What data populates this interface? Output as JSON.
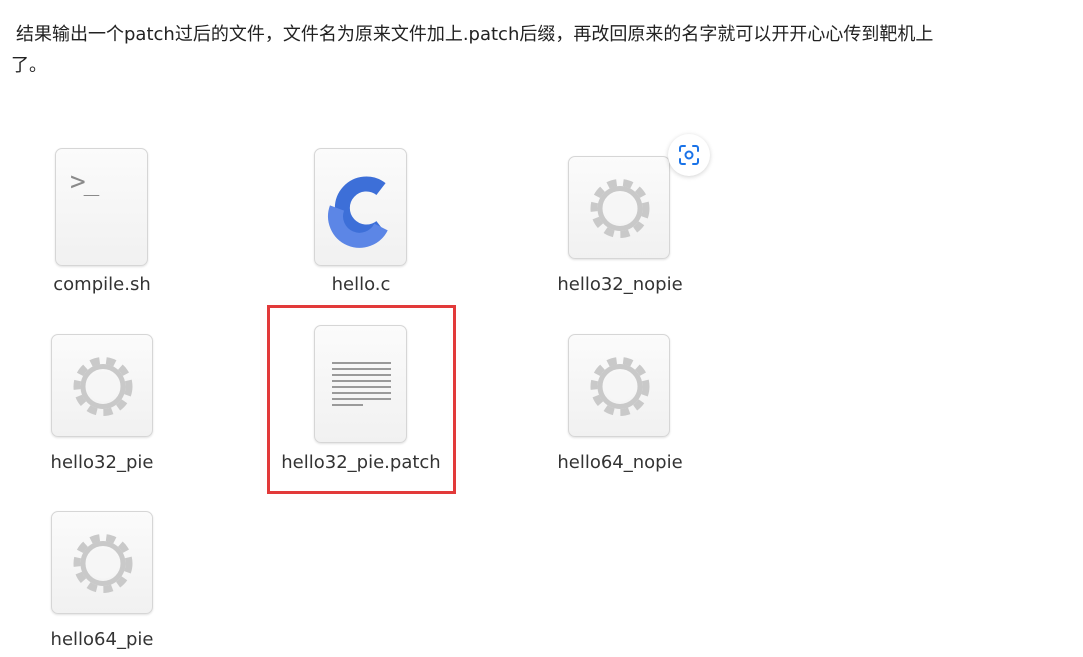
{
  "article": {
    "paragraph_line1": "结果输出一个patch过后的文件，文件名为原来文件加上.patch后缀，再改回原来的名字就可以开开心心传到靶机上",
    "paragraph_line2": "了。"
  },
  "files": [
    {
      "name": "compile.sh",
      "icon": "terminal-icon"
    },
    {
      "name": "hello.c",
      "icon": "c-source-icon"
    },
    {
      "name": "hello32_nopie",
      "icon": "gear-icon"
    },
    {
      "name": "hello32_pie",
      "icon": "gear-icon"
    },
    {
      "name": "hello32_pie.patch",
      "icon": "text-document-icon"
    },
    {
      "name": "hello64_nopie",
      "icon": "gear-icon"
    },
    {
      "name": "hello64_pie",
      "icon": "gear-icon"
    }
  ],
  "highlight": {
    "file": "hello32_pie.patch",
    "color": "#e23a3a"
  },
  "overlay": {
    "icon": "image-scan-icon",
    "accent": "#1a73e8"
  }
}
